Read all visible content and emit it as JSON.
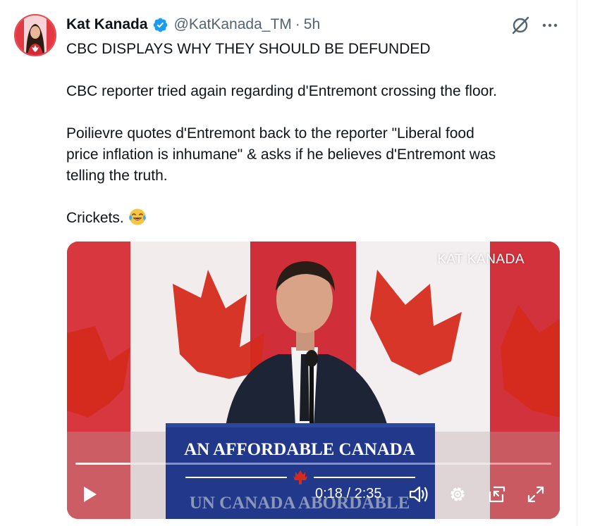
{
  "tweet": {
    "author_name": "Kat Kanada",
    "author_handle": "@KatKanada_TM",
    "separator": "·",
    "timestamp": "5h",
    "verified": true,
    "text_lines": [
      "CBC DISPLAYS WHY THEY SHOULD BE DEFUNDED",
      "",
      "CBC reporter tried again regarding d'Entremont crossing the floor.",
      "",
      "Poilievre quotes d'Entremont back to the reporter \"Liberal food",
      "price inflation is inhumane\" & asks if he believes d'Entremont was",
      "telling the truth.",
      "",
      "Crickets."
    ],
    "emoji": "face-with-tears-of-joy"
  },
  "media": {
    "watermark": "KAT KANADA",
    "podium_text_en": "AN AFFORDABLE CANADA",
    "podium_text_fr": "UN CANADA ABORDABLE",
    "player": {
      "current_time": "0:18",
      "duration": "2:35",
      "time_display": "0:18 / 2:35",
      "progress": 0.116
    }
  },
  "icons": {
    "verified": "verified-badge-icon",
    "grok": "grok-icon",
    "more": "more-options-icon",
    "play": "play-icon",
    "volume": "volume-icon",
    "settings": "settings-gear-icon",
    "pip": "picture-in-picture-icon",
    "fullscreen": "fullscreen-icon"
  },
  "colors": {
    "verified_blue": "#1d9bf0",
    "secondary_text": "#536471",
    "flag_red": "#d52b1e",
    "podium_blue": "#1f3680"
  }
}
